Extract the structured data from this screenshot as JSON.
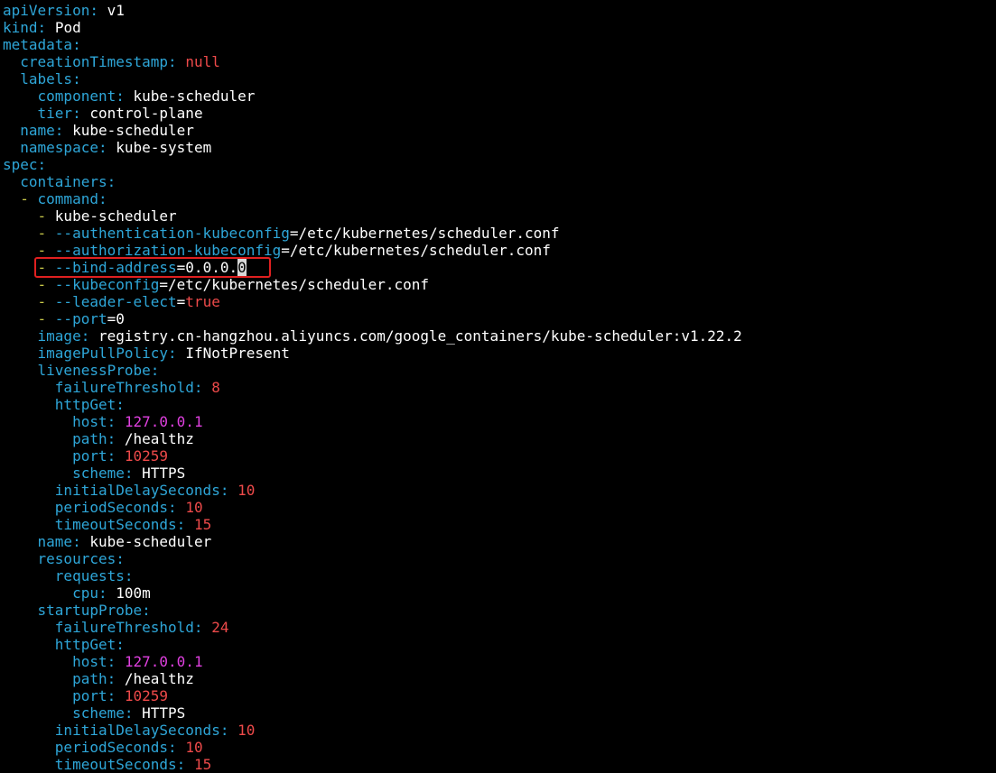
{
  "colors": {
    "key": "#2ea6d8",
    "dash": "#c9c94a",
    "value": "#ffffff",
    "number": "#ee4a4a",
    "ip": "#e040e0",
    "highlight": "#e02020"
  },
  "lines": [
    {
      "indent": 0,
      "key": "apiVersion",
      "value": "v1",
      "vtype": "val"
    },
    {
      "indent": 0,
      "key": "kind",
      "value": "Pod",
      "vtype": "val"
    },
    {
      "indent": 0,
      "key": "metadata",
      "value": "",
      "vtype": "val"
    },
    {
      "indent": 2,
      "key": "creationTimestamp",
      "value": "null",
      "vtype": "kw"
    },
    {
      "indent": 2,
      "key": "labels",
      "value": "",
      "vtype": "val"
    },
    {
      "indent": 4,
      "key": "component",
      "value": "kube-scheduler",
      "vtype": "val"
    },
    {
      "indent": 4,
      "key": "tier",
      "value": "control-plane",
      "vtype": "val"
    },
    {
      "indent": 2,
      "key": "name",
      "value": "kube-scheduler",
      "vtype": "val"
    },
    {
      "indent": 2,
      "key": "namespace",
      "value": "kube-system",
      "vtype": "val"
    },
    {
      "indent": 0,
      "key": "spec",
      "value": "",
      "vtype": "val"
    },
    {
      "indent": 2,
      "key": "containers",
      "value": "",
      "vtype": "val"
    },
    {
      "indent": 2,
      "dash": true,
      "key": "command",
      "value": "",
      "vtype": "val"
    },
    {
      "indent": 4,
      "dash": true,
      "plain": "kube-scheduler"
    },
    {
      "indent": 4,
      "dash": true,
      "flag": "--authentication-kubeconfig",
      "eq": "=",
      "value": "/etc/kubernetes/scheduler.conf",
      "vtype": "val"
    },
    {
      "indent": 4,
      "dash": true,
      "flag": "--authorization-kubeconfig",
      "eq": "=",
      "value": "/etc/kubernetes/scheduler.conf",
      "vtype": "val"
    },
    {
      "indent": 4,
      "dash": true,
      "flag": "--bind-address",
      "eq": "=",
      "value": "0.0.0.",
      "cursor": "0",
      "vtype": "val",
      "highlight": true
    },
    {
      "indent": 4,
      "dash": true,
      "flag": "--kubeconfig",
      "eq": "=",
      "value": "/etc/kubernetes/scheduler.conf",
      "vtype": "val"
    },
    {
      "indent": 4,
      "dash": true,
      "flag": "--leader-elect",
      "eq": "=",
      "value": "true",
      "vtype": "kw"
    },
    {
      "indent": 4,
      "dash": true,
      "flag": "--port",
      "eq": "=",
      "value": "0",
      "vtype": "val"
    },
    {
      "indent": 4,
      "key": "image",
      "value": "registry.cn-hangzhou.aliyuncs.com/google_containers/kube-scheduler:v1.22.2",
      "vtype": "val"
    },
    {
      "indent": 4,
      "key": "imagePullPolicy",
      "value": "IfNotPresent",
      "vtype": "val"
    },
    {
      "indent": 4,
      "key": "livenessProbe",
      "value": "",
      "vtype": "val"
    },
    {
      "indent": 6,
      "key": "failureThreshold",
      "value": "8",
      "vtype": "num"
    },
    {
      "indent": 6,
      "key": "httpGet",
      "value": "",
      "vtype": "val"
    },
    {
      "indent": 8,
      "key": "host",
      "value": "127.0.0.1",
      "vtype": "ip"
    },
    {
      "indent": 8,
      "key": "path",
      "value": "/healthz",
      "vtype": "val"
    },
    {
      "indent": 8,
      "key": "port",
      "value": "10259",
      "vtype": "num"
    },
    {
      "indent": 8,
      "key": "scheme",
      "value": "HTTPS",
      "vtype": "val"
    },
    {
      "indent": 6,
      "key": "initialDelaySeconds",
      "value": "10",
      "vtype": "num"
    },
    {
      "indent": 6,
      "key": "periodSeconds",
      "value": "10",
      "vtype": "num"
    },
    {
      "indent": 6,
      "key": "timeoutSeconds",
      "value": "15",
      "vtype": "num"
    },
    {
      "indent": 4,
      "key": "name",
      "value": "kube-scheduler",
      "vtype": "val"
    },
    {
      "indent": 4,
      "key": "resources",
      "value": "",
      "vtype": "val"
    },
    {
      "indent": 6,
      "key": "requests",
      "value": "",
      "vtype": "val"
    },
    {
      "indent": 8,
      "key": "cpu",
      "value": "100m",
      "vtype": "val"
    },
    {
      "indent": 4,
      "key": "startupProbe",
      "value": "",
      "vtype": "val"
    },
    {
      "indent": 6,
      "key": "failureThreshold",
      "value": "24",
      "vtype": "num"
    },
    {
      "indent": 6,
      "key": "httpGet",
      "value": "",
      "vtype": "val"
    },
    {
      "indent": 8,
      "key": "host",
      "value": "127.0.0.1",
      "vtype": "ip"
    },
    {
      "indent": 8,
      "key": "path",
      "value": "/healthz",
      "vtype": "val"
    },
    {
      "indent": 8,
      "key": "port",
      "value": "10259",
      "vtype": "num"
    },
    {
      "indent": 8,
      "key": "scheme",
      "value": "HTTPS",
      "vtype": "val"
    },
    {
      "indent": 6,
      "key": "initialDelaySeconds",
      "value": "10",
      "vtype": "num"
    },
    {
      "indent": 6,
      "key": "periodSeconds",
      "value": "10",
      "vtype": "num"
    },
    {
      "indent": 6,
      "key": "timeoutSeconds",
      "value": "15",
      "vtype": "num"
    }
  ]
}
